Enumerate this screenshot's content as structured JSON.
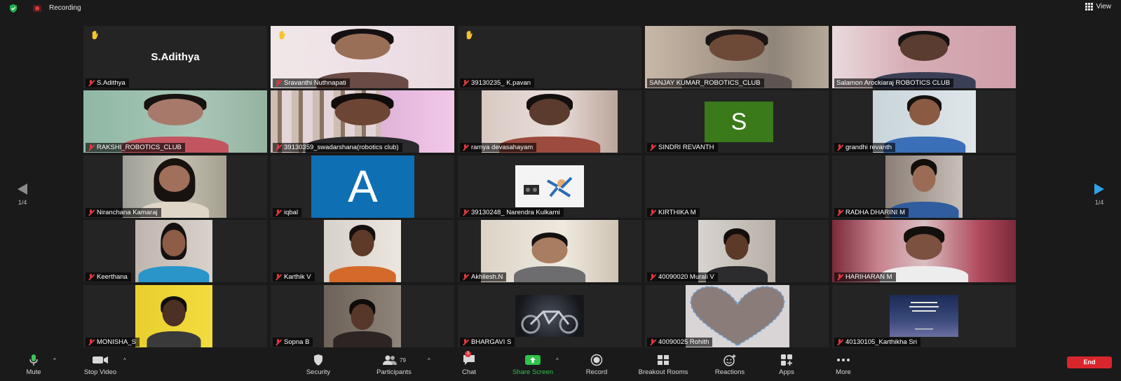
{
  "topbar": {
    "recording_label": "Recording",
    "view_label": "View"
  },
  "page": {
    "left_indicator": "1/4",
    "right_indicator": "1/4"
  },
  "participants": [
    {
      "name": "S.Adithya",
      "display": "S.Adithya",
      "hand_raised": true,
      "muted": true,
      "video": "name-card"
    },
    {
      "name": "Sravanthi Nuthnapati",
      "hand_raised": true,
      "muted": true,
      "video": "camera"
    },
    {
      "name": "39130235_ K.pavan",
      "hand_raised": true,
      "muted": true,
      "video": "off"
    },
    {
      "name": "SANJAY KUMAR_ROBOTICS_CLUB",
      "muted": false,
      "video": "camera"
    },
    {
      "name": "Salamon Arockiaraj ROBOTICS CLUB",
      "muted": false,
      "video": "camera",
      "active_speaker": true
    },
    {
      "name": "RAKSHI_ROBOTICS_CLUB",
      "muted": true,
      "video": "camera"
    },
    {
      "name": "39130359_swadarshana(robotics club)",
      "muted": true,
      "video": "camera"
    },
    {
      "name": "ramya devasahayam",
      "muted": true,
      "video": "camera"
    },
    {
      "name": "SINDRI REVANTH",
      "avatar_letter": "S",
      "muted": true,
      "video": "avatar"
    },
    {
      "name": "grandhi revanth",
      "muted": true,
      "video": "camera"
    },
    {
      "name": "Niranchana Kamaraj",
      "muted": true,
      "video": "camera"
    },
    {
      "name": "iqbal",
      "avatar_letter": "A",
      "muted": true,
      "video": "avatar"
    },
    {
      "name": "39130248_ Narendra Kulkarni",
      "muted": true,
      "video": "image"
    },
    {
      "name": "KIRTHIKA M",
      "muted": true,
      "video": "off"
    },
    {
      "name": "RADHA DHARINI M",
      "muted": true,
      "video": "camera"
    },
    {
      "name": "Keerthana",
      "muted": true,
      "video": "camera"
    },
    {
      "name": "Karthik V",
      "muted": true,
      "video": "camera"
    },
    {
      "name": "Akhilesh.N",
      "muted": true,
      "video": "camera"
    },
    {
      "name": "40090020 Murali V",
      "muted": true,
      "video": "camera"
    },
    {
      "name": "HARIHARAN M",
      "muted": true,
      "video": "camera"
    },
    {
      "name": "MONISHA_S",
      "muted": true,
      "video": "camera"
    },
    {
      "name": "Sopna B",
      "muted": true,
      "video": "camera"
    },
    {
      "name": "BHARGAVI S",
      "muted": true,
      "video": "image"
    },
    {
      "name": "40090025 Rohith",
      "muted": true,
      "video": "image"
    },
    {
      "name": "40130105_Karthikha Sri",
      "muted": true,
      "video": "image"
    }
  ],
  "toolbar": {
    "mute": "Mute",
    "stop_video": "Stop Video",
    "security": "Security",
    "participants": "Participants",
    "participants_count": "79",
    "chat": "Chat",
    "chat_badge": "3",
    "share_screen": "Share Screen",
    "record": "Record",
    "breakout_rooms": "Breakout Rooms",
    "reactions": "Reactions",
    "apps": "Apps",
    "more": "More",
    "end": "End"
  },
  "colors": {
    "background": "#1a1a1a",
    "tile": "#242424",
    "active_speaker_border": "#d6d33c",
    "share_green": "#2fc34a",
    "end_red": "#d9262c",
    "muted_red": "#e0383e",
    "next_page_blue": "#2da5e8"
  }
}
